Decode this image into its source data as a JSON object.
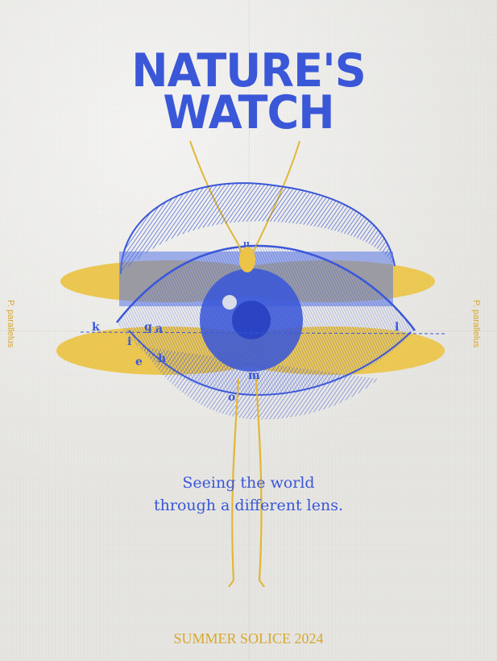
{
  "poster": {
    "title_line1": "NATURE'S",
    "title_line2": "WATCH",
    "side_left": "P. parallelus",
    "side_right": "P. parallelus",
    "diagram_labels": [
      "k",
      "g",
      "a",
      "i",
      "e",
      "h",
      "u",
      "m",
      "o",
      "l"
    ],
    "tagline_line1": "Seeing the world",
    "tagline_line2": "through a different lens.",
    "footer": "SUMMER SOLICE 2024"
  },
  "colors": {
    "blue": "#3a57d8",
    "yellow": "#e9c24a",
    "paper": "#e7e6e2"
  }
}
